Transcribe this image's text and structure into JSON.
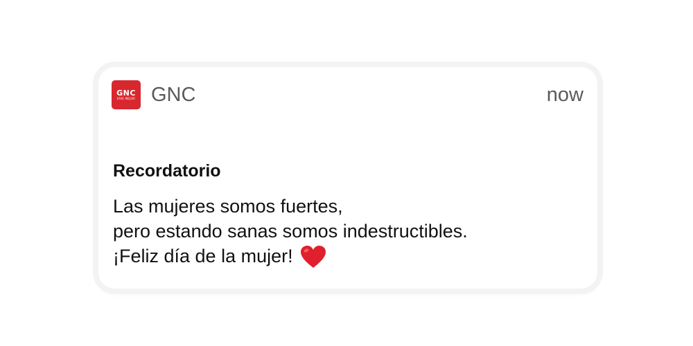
{
  "notification": {
    "app_logo": {
      "brand": "GNC",
      "tagline": "VIVE MEJOR",
      "color": "#d8282f"
    },
    "app_name": "GNC",
    "timestamp": "now",
    "title": "Recordatorio",
    "body_lines": [
      "Las mujeres somos fuertes,",
      "pero estando sanas somos indestructibles.",
      "¡Feliz día de la mujer!"
    ],
    "emoji": "heart-icon"
  }
}
